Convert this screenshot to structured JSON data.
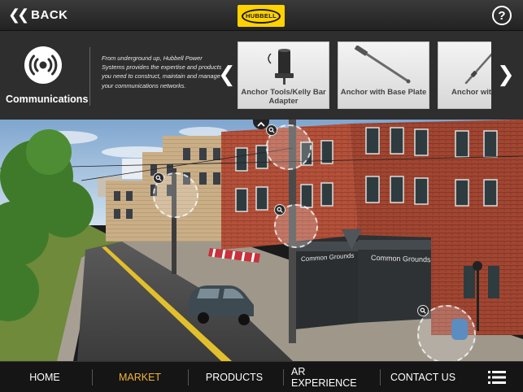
{
  "header": {
    "back_label": "BACK",
    "logo_text": "HUBBELL",
    "help_glyph": "?"
  },
  "category": {
    "icon": "signal-broadcast-icon",
    "name": "Communications",
    "description": "From underground up, Hubbell Power Systems provides the expertise and products you need to construct, maintain and manage your communications networks."
  },
  "carousel": {
    "prev_glyph": "❮",
    "next_glyph": "❯",
    "products": [
      {
        "label": "Anchor Tools/Kelly Bar Adapter"
      },
      {
        "label": "Anchor with Base Plate"
      },
      {
        "label": "Anchor wit"
      }
    ]
  },
  "scene": {
    "storefront_sign": "Common Grounds",
    "storefront_sign_side": "Common Grounds"
  },
  "nav": {
    "items": [
      {
        "label": "HOME"
      },
      {
        "label": "MARKET"
      },
      {
        "label": "PRODUCTS"
      },
      {
        "label": "AR EXPERIENCE"
      },
      {
        "label": "CONTACT US"
      }
    ],
    "active_index": 1,
    "accent_color": "#f3b23c"
  }
}
